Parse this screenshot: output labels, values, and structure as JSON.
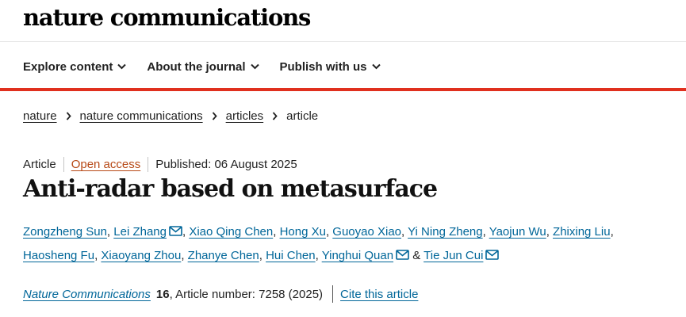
{
  "header": {
    "logo": "nature communications"
  },
  "nav": {
    "items": [
      {
        "label": "Explore content"
      },
      {
        "label": "About the journal"
      },
      {
        "label": "Publish with us"
      }
    ]
  },
  "breadcrumb": {
    "items": [
      "nature",
      "nature communications",
      "articles"
    ],
    "current": "article"
  },
  "article": {
    "type": "Article",
    "access": "Open access",
    "published": "Published: 06 August 2025",
    "title": "Anti-radar based on metasurface",
    "authors": [
      "Zongzheng Sun",
      "Lei Zhang",
      "Xiao Qing Chen",
      "Hong Xu",
      "Guoyao Xiao",
      "Yi Ning Zheng",
      "Yaojun Wu",
      "Zhixing Liu",
      "Haosheng Fu",
      "Xiaoyang Zhou",
      "Zhanye Chen",
      "Hui Chen",
      "Yinghui Quan",
      "Tie Jun Cui"
    ]
  },
  "citation": {
    "journal": "Nature Communications",
    "volume": "16",
    "details": ", Article number: 7258 (2025)",
    "cite_label": "Cite this article"
  },
  "colors": {
    "accent_red": "#e0301e",
    "link_blue": "#006699",
    "open_access": "#b74916"
  }
}
